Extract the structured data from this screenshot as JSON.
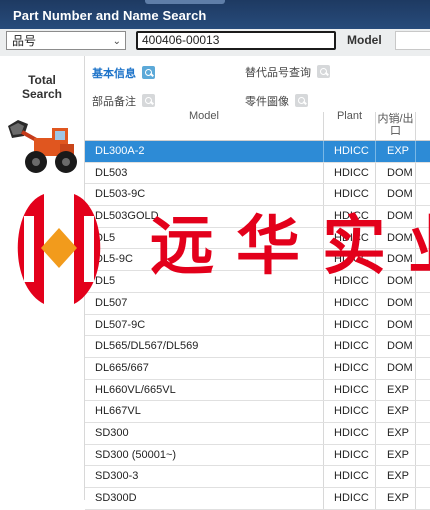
{
  "header": {
    "title": "Part Number and Name Search"
  },
  "search": {
    "type_select": "品号",
    "part_number": "400406-00013",
    "model_label": "Model",
    "model_value": ""
  },
  "left_panel": {
    "total_search_line1": "Total",
    "total_search_line2": "Search"
  },
  "tabs": [
    {
      "label": "基本信息",
      "active": true
    },
    {
      "label": "替代品号查询",
      "active": false
    },
    {
      "label": "部品备注",
      "active": false
    },
    {
      "label": "零件圖像",
      "active": false
    }
  ],
  "table": {
    "headers": {
      "model": "Model",
      "plant": "Plant",
      "dom": "内销/出口"
    },
    "rows": [
      {
        "model": "DL300A-2",
        "plant": "HDICC",
        "dom": "EXP",
        "selected": true
      },
      {
        "model": "DL503",
        "plant": "HDICC",
        "dom": "DOM"
      },
      {
        "model": "DL503-9C",
        "plant": "HDICC",
        "dom": "DOM"
      },
      {
        "model": "DL503GOLD",
        "plant": "HDICC",
        "dom": "DOM"
      },
      {
        "model": "DL5",
        "plant": "HDICC",
        "dom": "DOM"
      },
      {
        "model": "DL5-9C",
        "plant": "HDICC",
        "dom": "DOM"
      },
      {
        "model": "DL5",
        "plant": "HDICC",
        "dom": "DOM"
      },
      {
        "model": "DL507",
        "plant": "HDICC",
        "dom": "DOM"
      },
      {
        "model": "DL507-9C",
        "plant": "HDICC",
        "dom": "DOM"
      },
      {
        "model": "DL565/DL567/DL569",
        "plant": "HDICC",
        "dom": "DOM"
      },
      {
        "model": "DL665/667",
        "plant": "HDICC",
        "dom": "DOM"
      },
      {
        "model": "HL660VL/665VL",
        "plant": "HDICC",
        "dom": "EXP"
      },
      {
        "model": "HL667VL",
        "plant": "HDICC",
        "dom": "EXP"
      },
      {
        "model": "SD300",
        "plant": "HDICC",
        "dom": "EXP"
      },
      {
        "model": "SD300 (50001~)",
        "plant": "HDICC",
        "dom": "EXP"
      },
      {
        "model": "SD300-3",
        "plant": "HDICC",
        "dom": "EXP"
      },
      {
        "model": "SD300D",
        "plant": "HDICC",
        "dom": "EXP"
      }
    ]
  },
  "watermark": {
    "text": "远华实业",
    "color": "#e3001b"
  },
  "colors": {
    "titlebar": "#1e3a62",
    "selected_row": "#2d8bd6",
    "accent": "#1d73c9"
  }
}
